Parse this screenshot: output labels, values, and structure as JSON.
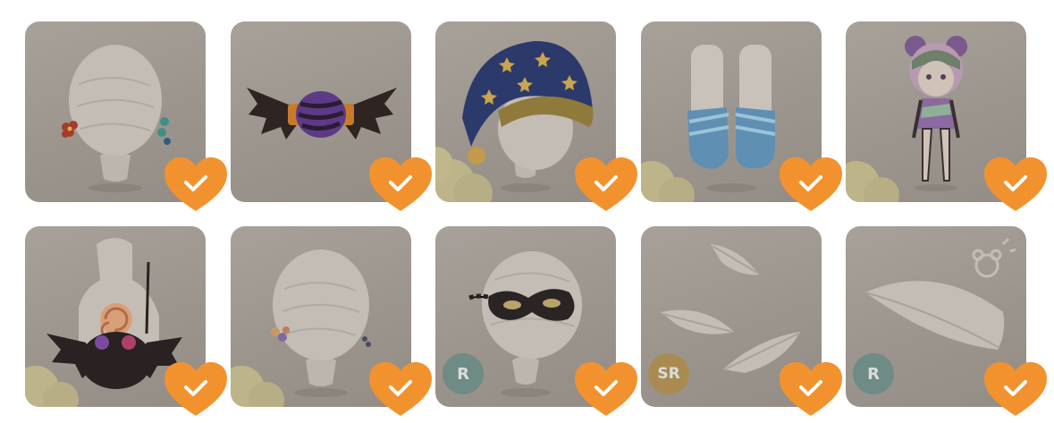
{
  "colors": {
    "card_bg": "#9e978f",
    "heart": "#f2922e",
    "check": "#ffffff",
    "badge_r": "#6e8b86",
    "badge_sr": "#a98b52"
  },
  "items": [
    {
      "name": "flower-earrings",
      "owned": true,
      "rarity": ""
    },
    {
      "name": "bat-wing-candy-hair-clip",
      "owned": true,
      "rarity": ""
    },
    {
      "name": "starry-night-cap",
      "owned": true,
      "rarity": ""
    },
    {
      "name": "blue-ballet-shoes",
      "owned": true,
      "rarity": ""
    },
    {
      "name": "halloween-outfit-avatar",
      "owned": true,
      "rarity": ""
    },
    {
      "name": "bat-candy-bag",
      "owned": true,
      "rarity": ""
    },
    {
      "name": "flower-hair-pins",
      "owned": true,
      "rarity": ""
    },
    {
      "name": "black-eye-mask",
      "owned": true,
      "rarity": "R"
    },
    {
      "name": "floating-feathers",
      "owned": true,
      "rarity": "SR"
    },
    {
      "name": "white-feather",
      "owned": true,
      "rarity": "R"
    }
  ]
}
